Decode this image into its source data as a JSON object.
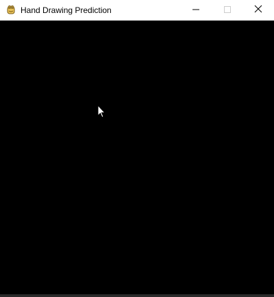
{
  "window": {
    "title": "Hand Drawing Prediction",
    "app_icon": "pygame-snake-icon",
    "controls": {
      "minimize_icon": "minimize-icon",
      "maximize_icon": "maximize-icon",
      "close_icon": "close-icon",
      "maximize_enabled": false
    }
  },
  "canvas": {
    "background_color": "#000000",
    "cursor_icon": "arrow-cursor-icon"
  }
}
